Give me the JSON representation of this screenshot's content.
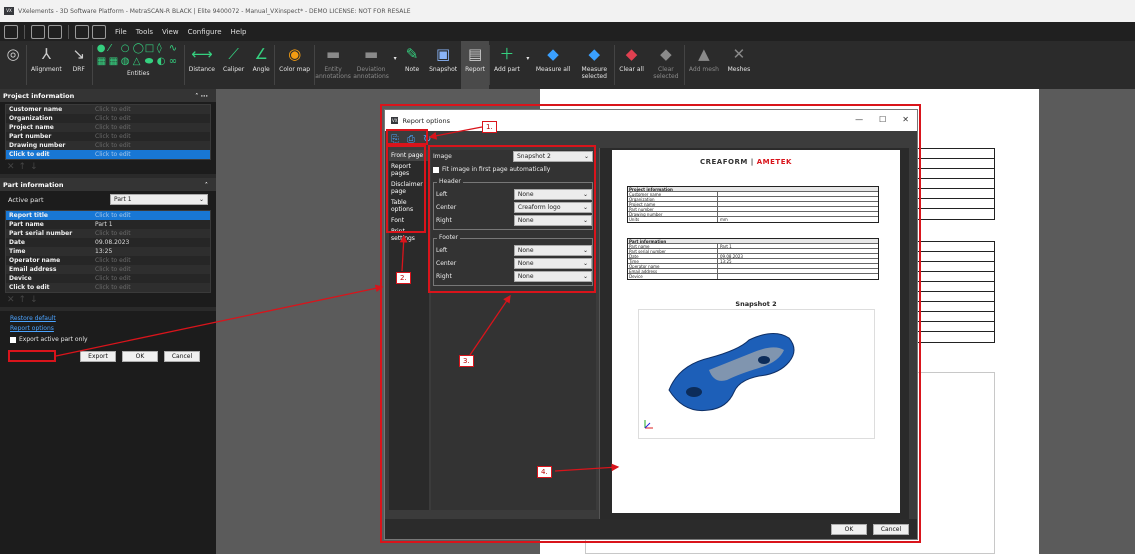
{
  "app": {
    "title": "VXelements - 3D Software Platform - MetraSCAN-R BLACK | Elite 9400072 - Manual_VXinspect* - DEMO LICENSE: NOT FOR RESALE",
    "icon_text": "VX"
  },
  "menu": [
    "File",
    "Tools",
    "View",
    "Configure",
    "Help"
  ],
  "ribbon": {
    "alignment": "Alignment",
    "drf": "DRF",
    "entities": "Entities",
    "distance": "Distance",
    "caliper": "Caliper",
    "angle": "Angle",
    "color_map": "Color map",
    "entity_ann": "Entity annotations",
    "deviation_ann": "Deviation annotations",
    "note": "Note",
    "snapshot": "Snapshot",
    "report": "Report",
    "add_part": "Add part",
    "measure_all": "Measure all",
    "measure_selected": "Measure selected",
    "clear_all": "Clear all",
    "clear_selected": "Clear selected",
    "add_mesh": "Add mesh",
    "meshes": "Meshes"
  },
  "project": {
    "header": "Project information",
    "rows": [
      {
        "k": "Customer name",
        "v": "Click to edit"
      },
      {
        "k": "Organization",
        "v": "Click to edit"
      },
      {
        "k": "Project name",
        "v": "Click to edit"
      },
      {
        "k": "Part number",
        "v": "Click to edit"
      },
      {
        "k": "Drawing number",
        "v": "Click to edit"
      },
      {
        "k": "Click to edit",
        "v": "Click to edit"
      }
    ]
  },
  "part": {
    "header": "Part information",
    "active_label": "Active part",
    "active_value": "Part 1",
    "rows": [
      {
        "k": "Report title",
        "v": "Click to edit"
      },
      {
        "k": "Part name",
        "v": "Part 1"
      },
      {
        "k": "Part serial number",
        "v": "Click to edit"
      },
      {
        "k": "Date",
        "v": "09.08.2023"
      },
      {
        "k": "Time",
        "v": "13:25"
      },
      {
        "k": "Operator name",
        "v": "Click to edit"
      },
      {
        "k": "Email address",
        "v": "Click to edit"
      },
      {
        "k": "Device",
        "v": "Click to edit"
      },
      {
        "k": "Click to edit",
        "v": "Click to edit"
      }
    ]
  },
  "panel": {
    "restore": "Restore default",
    "report_options": "Report options",
    "export_active": "Export active part only",
    "export": "Export",
    "ok": "OK",
    "cancel": "Cancel"
  },
  "dialog": {
    "title": "Report options",
    "nav": [
      "Front page",
      "Report pages",
      "Disclaimer page",
      "Table options",
      "Font",
      "Print settings"
    ],
    "image_label": "Image",
    "image_value": "Snapshot 2",
    "fit_label": "Fit image in first page automatically",
    "header_group": "Header",
    "footer_group": "Footer",
    "left": "Left",
    "center": "Center",
    "right": "Right",
    "header_left": "None",
    "header_center": "Creaform logo",
    "header_right": "None",
    "footer_left": "None",
    "footer_center": "None",
    "footer_right": "None",
    "ok": "OK",
    "cancel": "Cancel"
  },
  "preview": {
    "logo_a": "CREAFORM",
    "logo_b": "AMETEK",
    "proj_title": "Project information",
    "proj_rows": [
      {
        "k": "Customer name",
        "v": ""
      },
      {
        "k": "Organization",
        "v": ""
      },
      {
        "k": "Project name",
        "v": ""
      },
      {
        "k": "Part number",
        "v": ""
      },
      {
        "k": "Drawing number",
        "v": ""
      },
      {
        "k": "Units",
        "v": "mm"
      }
    ],
    "part_title": "Part information",
    "part_rows": [
      {
        "k": "Part name",
        "v": "Part 1"
      },
      {
        "k": "Part serial number",
        "v": ""
      },
      {
        "k": "Date",
        "v": "09.08.2023"
      },
      {
        "k": "Time",
        "v": "13:25"
      },
      {
        "k": "Operator name",
        "v": ""
      },
      {
        "k": "Email address",
        "v": ""
      },
      {
        "k": "Device",
        "v": ""
      }
    ],
    "snapshot_title": "Snapshot 2"
  },
  "callouts": [
    "1.",
    "2.",
    "3.",
    "4."
  ],
  "colors": {
    "annotation_red": "#d9141b",
    "selection_blue": "#1877d4",
    "link_blue": "#4ba3ff"
  }
}
